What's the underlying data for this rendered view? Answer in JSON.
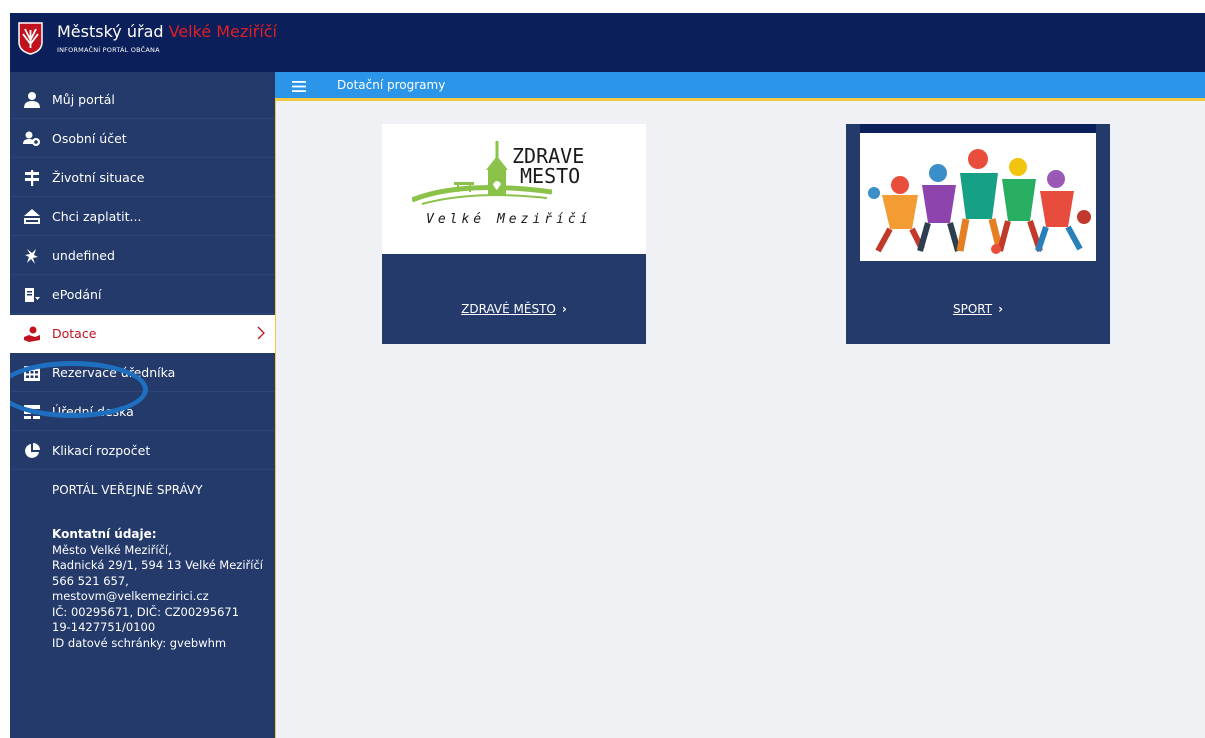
{
  "header": {
    "title_prefix": "Městský úřad",
    "title_city": "Velké Meziříčí",
    "subtitle": "INFORMAČNÍ PORTÁL OBČANA"
  },
  "sidebar": {
    "items": [
      {
        "label": "Můj portál",
        "icon": "user-icon"
      },
      {
        "label": "Osobní účet",
        "icon": "account-icon"
      },
      {
        "label": "Životní situace",
        "icon": "signpost-icon"
      },
      {
        "label": "Chci zaplatit...",
        "icon": "payment-icon"
      },
      {
        "label": "undefined",
        "icon": "heraldic-icon"
      },
      {
        "label": "ePodání",
        "icon": "e-submission-icon"
      },
      {
        "label": "Dotace",
        "icon": "subsidy-icon",
        "active": true
      },
      {
        "label": "Rezervace úředníka",
        "icon": "calendar-icon"
      },
      {
        "label": "Úřední deska",
        "icon": "board-icon"
      },
      {
        "label": "Klikací rozpočet",
        "icon": "pie-chart-icon"
      }
    ],
    "portal_link": "PORTÁL VEŘEJNÉ SPRÁVY",
    "contact": {
      "title": "Kontatní údaje:",
      "lines": [
        "Město Velké Meziříčí,",
        "Radnická 29/1, 594 13 Velké Meziříčí",
        "566 521 657,",
        "mestovm@velkemezirici.cz",
        "IČ: 00295671, DIČ: CZ00295671",
        "19-1427751/0100",
        "ID datové schránky: gvebwhm"
      ]
    }
  },
  "content": {
    "title": "Dotační programy",
    "cards": [
      {
        "label": "ZDRAVÉ MĚSTO",
        "logo_line1": "ZDRAVE",
        "logo_line2": "MESTO",
        "logo_sub": "Velké Meziříčí"
      },
      {
        "label": "SPORT"
      }
    ]
  },
  "colors": {
    "header_bg": "#0b1f5a",
    "sidebar_bg": "#233a6b",
    "content_bar": "#2b95e9",
    "accent_red": "#c1121f",
    "highlight": "#1e6fbf"
  }
}
